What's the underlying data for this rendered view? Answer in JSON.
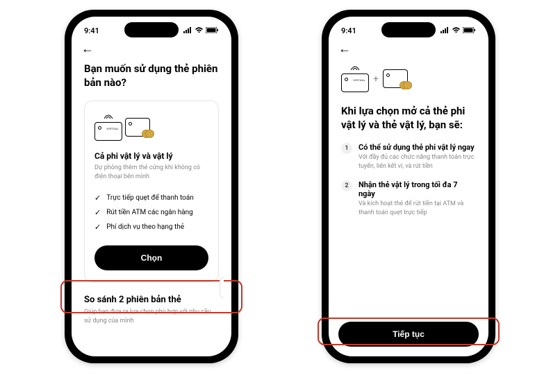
{
  "status": {
    "time": "9:41"
  },
  "screen1": {
    "title": "Bạn muốn sử dụng thẻ phiên bản nào?",
    "card": {
      "virtualLabel": "VIRTUAL",
      "title": "Cả phi vật lý và vật lý",
      "desc": "Dự phòng thêm thẻ cứng khi không có điện thoại bên mình",
      "features": [
        "Trực tiếp quẹt để thanh toán",
        "Rút tiền ATM các ngân hàng",
        "Phí dịch vụ theo hạng thẻ"
      ],
      "button": "Chọn"
    },
    "compare": {
      "title": "So sánh 2 phiên bản thẻ",
      "desc": "Giúp bạn đưa ra lựa chọn phù hợp với nhu cầu sử dụng của mình"
    }
  },
  "screen2": {
    "virtualLabel": "VIRTUAL",
    "title": "Khi lựa chọn mở cả thẻ phi vật lý và thẻ vật lý, bạn sẽ:",
    "items": [
      {
        "num": "1",
        "title": "Có thể sử dụng thẻ phi vật lý ngay",
        "desc": "Với đầy đủ các chức năng thanh toán trực tuyến, liên kết ví, và rút tiền"
      },
      {
        "num": "2",
        "title": "Nhận thẻ vật lý trong tối đa 7 ngày",
        "desc": "Và kích hoạt thẻ để rút tiền tại ATM và thanh toán quẹt trực tiếp"
      }
    ],
    "button": "Tiếp tục"
  }
}
